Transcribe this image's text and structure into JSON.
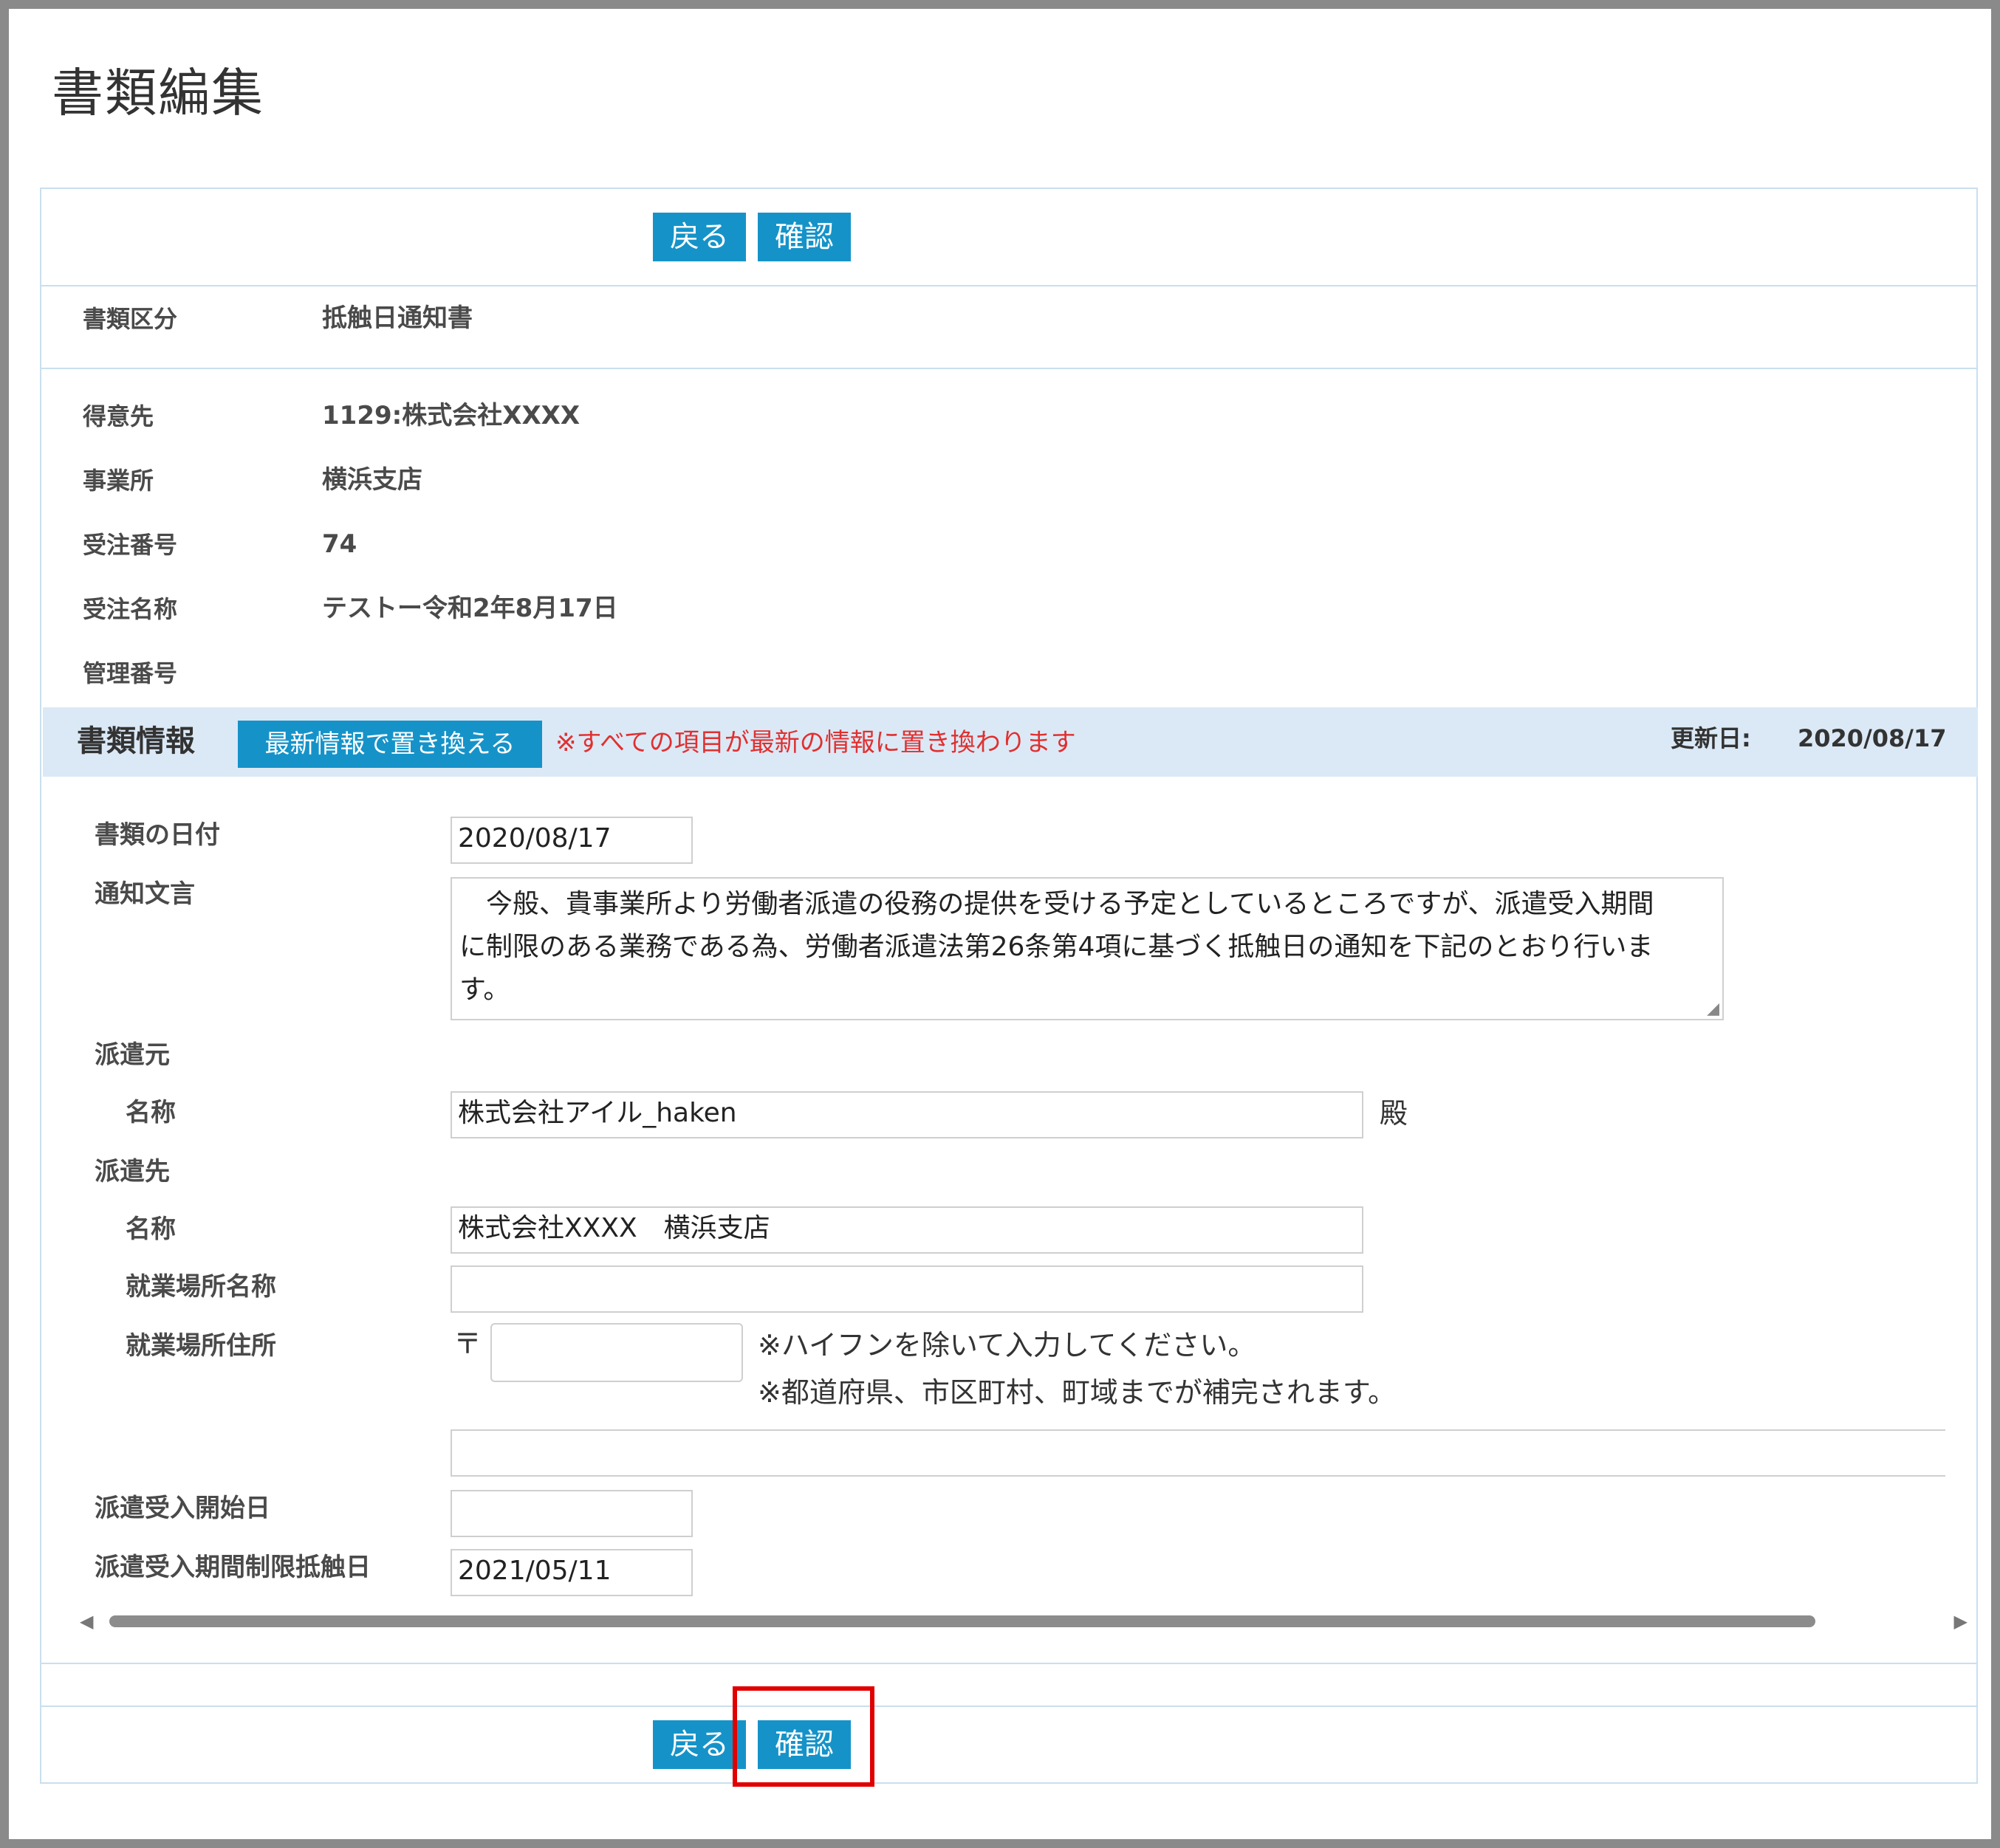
{
  "page": {
    "title": "書類編集"
  },
  "toolbar": {
    "back_label": "戻る",
    "confirm_label": "確認"
  },
  "summary": {
    "doc_type_label": "書類区分",
    "doc_type_value": "抵触日通知書",
    "client_label": "得意先",
    "client_value": "1129:株式会社XXXX",
    "office_label": "事業所",
    "office_value": "横浜支店",
    "order_no_label": "受注番号",
    "order_no_value": "74",
    "order_name_label": "受注名称",
    "order_name_value": "テストー令和2年8月17日",
    "mgmt_no_label": "管理番号",
    "mgmt_no_value": ""
  },
  "doc_info": {
    "heading": "書類情報",
    "replace_button": "最新情報で置き換える",
    "replace_note": "※すべての項目が最新の情報に置き換わります",
    "updated_label": "更新日:",
    "updated_value": "2020/08/17"
  },
  "form": {
    "doc_date_label": "書類の日付",
    "doc_date_value": "2020/08/17",
    "notice_label": "通知文言",
    "notice_line1": "　今般、貴事業所より労働者派遣の役務の提供を受ける予定としているところですが、派遣受入期間",
    "notice_line2": "に制限のある業務である為、労働者派遣法第26条第4項に基づく抵触日の通知を下記のとおり行いま",
    "notice_line3": "す。",
    "dispatcher_label": "派遣元",
    "dispatcher_name_label": "名称",
    "dispatcher_name_value": "株式会社アイル_haken",
    "dispatcher_suffix": "殿",
    "client_label": "派遣先",
    "client_name_label": "名称",
    "client_name_value": "株式会社XXXX　横浜支店",
    "workplace_name_label": "就業場所名称",
    "workplace_name_value": "",
    "workplace_address_label": "就業場所住所",
    "postal_mark": "〒",
    "postal_value": "",
    "postal_note1": "※ハイフンを除いて入力してください。",
    "postal_note2": "※都道府県、市区町村、町域までが補完されます。",
    "address_value": "",
    "start_date_label": "派遣受入開始日",
    "start_date_value": "",
    "conflict_date_label": "派遣受入期間制限抵触日",
    "conflict_date_value": "2021/05/11"
  },
  "colors": {
    "accent": "#1593c9",
    "section_bg": "#dbe9f6",
    "warning": "#e03030",
    "highlight": "#e00000"
  }
}
